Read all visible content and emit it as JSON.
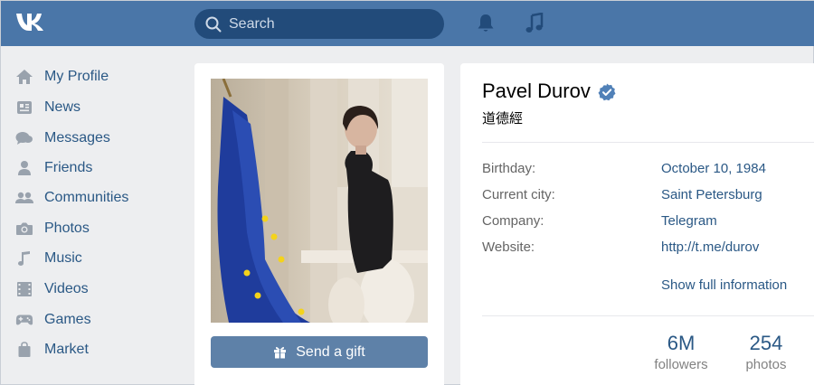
{
  "header": {
    "logo": "VK",
    "search_placeholder": "Search"
  },
  "sidebar": {
    "items": [
      {
        "label": "My Profile",
        "icon": "home-icon"
      },
      {
        "label": "News",
        "icon": "news-icon"
      },
      {
        "label": "Messages",
        "icon": "messages-icon"
      },
      {
        "label": "Friends",
        "icon": "friends-icon"
      },
      {
        "label": "Communities",
        "icon": "communities-icon"
      },
      {
        "label": "Photos",
        "icon": "camera-icon"
      },
      {
        "label": "Music",
        "icon": "music-icon"
      },
      {
        "label": "Videos",
        "icon": "video-icon"
      },
      {
        "label": "Games",
        "icon": "gamepad-icon"
      },
      {
        "label": "Market",
        "icon": "bag-icon"
      }
    ]
  },
  "profile": {
    "name": "Pavel Durov",
    "status": "道德經",
    "send_gift": "Send a gift",
    "details": [
      {
        "label": "Birthday:",
        "value": "October 10, 1984"
      },
      {
        "label": "Current city:",
        "value": "Saint Petersburg"
      },
      {
        "label": "Company:",
        "value": "Telegram"
      },
      {
        "label": "Website:",
        "value": "http://t.me/durov"
      }
    ],
    "show_full": "Show full information",
    "stats": [
      {
        "count": "6M",
        "caption": "followers"
      },
      {
        "count": "254",
        "caption": "photos"
      }
    ]
  },
  "colors": {
    "header_bg": "#4a76a8",
    "link": "#2a5885",
    "page_bg": "#edeef0",
    "button": "#5e81a8"
  }
}
